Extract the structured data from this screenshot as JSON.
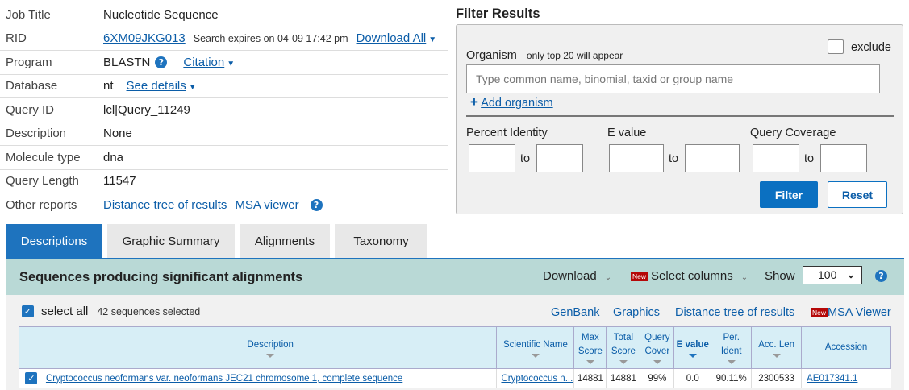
{
  "info": {
    "job_title_label": "Job Title",
    "job_title": "Nucleotide Sequence",
    "rid_label": "RID",
    "rid": "6XM09JKG013",
    "rid_expires": "Search expires on 04-09 17:42 pm",
    "download_all": "Download All",
    "program_label": "Program",
    "program": "BLASTN",
    "citation": "Citation",
    "database_label": "Database",
    "database": "nt",
    "see_details": "See details",
    "query_id_label": "Query ID",
    "query_id": "lcl|Query_11249",
    "description_label": "Description",
    "description": "None",
    "molecule_type_label": "Molecule type",
    "molecule_type": "dna",
    "query_length_label": "Query Length",
    "query_length": "11547",
    "other_reports_label": "Other reports",
    "distance_tree": "Distance tree of results",
    "msa_viewer": "MSA viewer"
  },
  "filter": {
    "title": "Filter Results",
    "organism_label": "Organism",
    "organism_hint": "only top 20 will appear",
    "exclude_label": "exclude",
    "organism_placeholder": "Type common  name, binomial, taxid or group  name",
    "add_organism": "Add organism",
    "percent_identity": "Percent Identity",
    "e_value": "E value",
    "query_coverage": "Query Coverage",
    "to": "to",
    "filter_button": "Filter",
    "reset_button": "Reset"
  },
  "tabs": [
    "Descriptions",
    "Graphic Summary",
    "Alignments",
    "Taxonomy"
  ],
  "results": {
    "title": "Sequences producing significant alignments",
    "download": "Download",
    "new_badge": "New",
    "select_columns": "Select columns",
    "show_label": "Show",
    "show_value": "100",
    "select_all": "select all",
    "selected_count": "42 sequences selected",
    "links": [
      "GenBank",
      "Graphics",
      "Distance tree of results"
    ],
    "msa_viewer": "MSA Viewer",
    "columns": [
      "Description",
      "Scientific Name",
      "Max Score",
      "Total Score",
      "Query Cover",
      "E value",
      "Per. Ident",
      "Acc. Len",
      "Accession"
    ],
    "rows": [
      {
        "description": "Cryptococcus neoformans var. neoformans JEC21 chromosome 1, complete sequence",
        "scientific_name": "Cryptococcus n...",
        "max_score": "14881",
        "total_score": "14881",
        "query_cover": "99%",
        "e_value": "0.0",
        "per_ident": "90.11%",
        "acc_len": "2300533",
        "accession": "AE017341.1"
      }
    ]
  }
}
